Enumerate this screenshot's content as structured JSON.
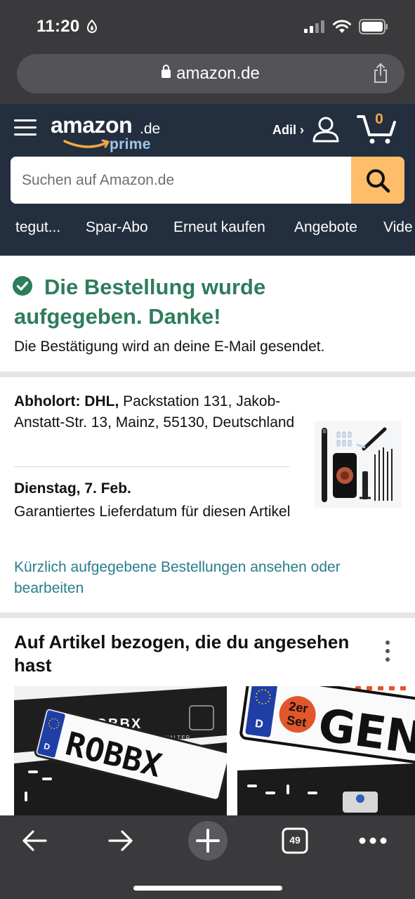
{
  "status_bar": {
    "time": "11:20"
  },
  "browser": {
    "url": "amazon.de",
    "tab_count": "49"
  },
  "header": {
    "logo_text": "amazon",
    "logo_tld": ".de",
    "logo_prime": "prime",
    "account_label": "Adil ›",
    "cart_count": "0",
    "search_placeholder": "Suchen auf Amazon.de",
    "accent_color": "#febd69",
    "nav_items": [
      "tegut...",
      "Spar-Abo",
      "Erneut kaufen",
      "Angebote",
      "Vide"
    ]
  },
  "confirmation": {
    "title": "Die Bestellung wurde aufgegeben. Danke!",
    "subtitle": "Die Bestätigung wird an deine E-Mail gesendet.",
    "title_color": "#2e7d5b"
  },
  "delivery": {
    "pickup_label": "Abholort: DHL,",
    "pickup_address": "Packstation 131, Jakob-Anstatt-Str. 13, Mainz, 55130, Deutschland",
    "date": "Dienstag, 7. Feb.",
    "guarantee": "Garantiertes Lieferdatum für diesen Artikel",
    "orders_link": "Kürzlich aufgegebene Bestellungen ansehen oder bearbeiten",
    "link_color": "#2a7c8e"
  },
  "related": {
    "title": "Auf Artikel bezogen, die du angesehen hast",
    "item1_brand": "ROBBX",
    "item1_caption": "PREMIUM KENNZEICHENHALTER",
    "item1_plate": "ROBBX",
    "item2_badge_line1": "2er",
    "item2_badge_line2": "Set",
    "item2_plate": "GEN",
    "plate_country": "D"
  }
}
